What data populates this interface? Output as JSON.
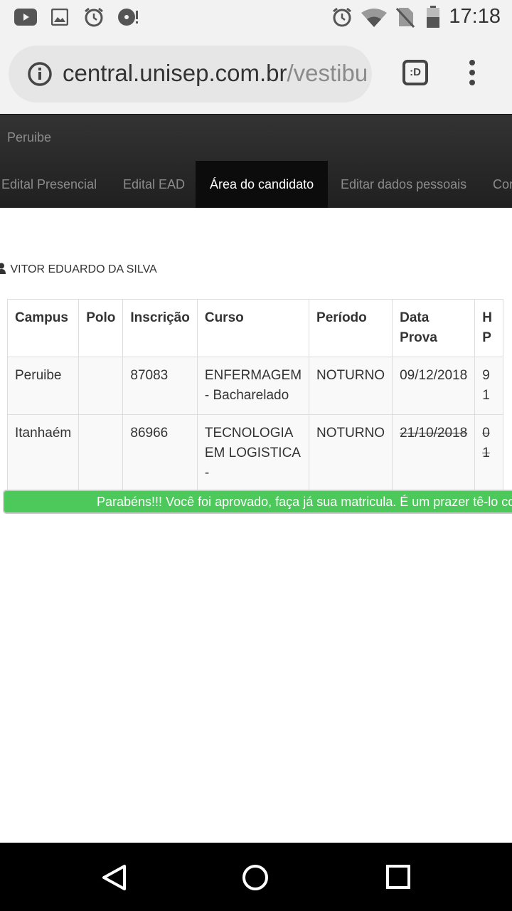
{
  "status_bar": {
    "time": "17:18",
    "left_icons": [
      "youtube-icon",
      "image-icon",
      "alarm-icon",
      "disc-alert-icon"
    ],
    "right_icons": [
      "alarm-icon",
      "wifi-icon",
      "no-sim-icon",
      "battery-icon"
    ]
  },
  "browser": {
    "url_domain": "central.unisep.com.br",
    "url_path": "/vestibu",
    "tab_badge": ":D"
  },
  "site": {
    "brand": "Peruibe",
    "tabs": [
      {
        "label": "Edital Presencial",
        "active": false
      },
      {
        "label": "Edital EAD",
        "active": false
      },
      {
        "label": "Área do candidato",
        "active": true
      },
      {
        "label": "Editar dados pessoais",
        "active": false
      },
      {
        "label": "Cor",
        "active": false
      }
    ]
  },
  "candidate": {
    "name": "VITOR EDUARDO DA SILVA"
  },
  "table": {
    "headers": [
      "Campus",
      "Polo",
      "Inscrição",
      "Curso",
      "Período",
      "Data Prova",
      "H",
      "P"
    ],
    "rows": [
      {
        "campus": "Peruibe",
        "polo": "",
        "inscricao": "87083",
        "curso_line1": "ENFERMAGEM",
        "curso_line2": "- Bacharelado",
        "curso_line3": "",
        "periodo": "NOTURNO",
        "data_prova": "09/12/2018",
        "h1": "9",
        "h2": "1"
      },
      {
        "campus": "Itanhaém",
        "polo": "",
        "inscricao": "86966",
        "curso_line1": "TECNOLOGIA",
        "curso_line2": "EM LOGISTICA",
        "curso_line3": "-",
        "periodo": "NOTURNO",
        "data_prova": "21/10/2018",
        "h1": "0",
        "h2": "1"
      }
    ]
  },
  "banner": {
    "message": "Parabéns!!! Você foi aprovado, faça já sua matricula. É um prazer tê-lo cor",
    "color": "#4cc95a"
  },
  "colors": {
    "nav_bg": "#252525",
    "active_tab_bg": "#0c0c0c"
  }
}
